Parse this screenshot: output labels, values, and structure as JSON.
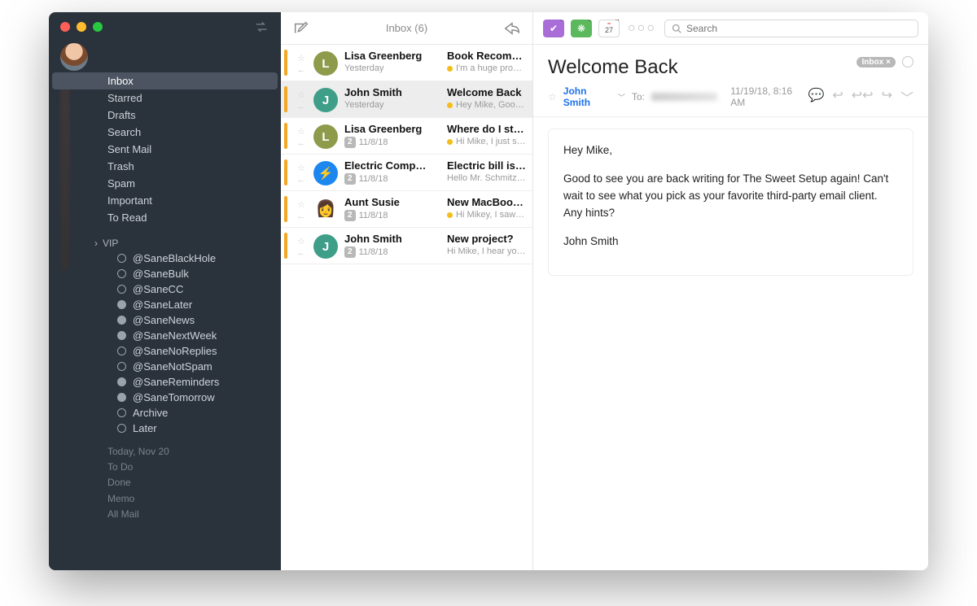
{
  "sidebar": {
    "folders": [
      "Inbox",
      "Starred",
      "Drafts",
      "Search",
      "Sent Mail",
      "Trash",
      "Spam",
      "Important",
      "To Read"
    ],
    "selected_index": 0,
    "vip_label": "VIP",
    "sane": [
      "@SaneBlackHole",
      "@SaneBulk",
      "@SaneCC",
      "@SaneLater",
      "@SaneNews",
      "@SaneNextWeek",
      "@SaneNoReplies",
      "@SaneNotSpam",
      "@SaneReminders",
      "@SaneTomorrow",
      "Archive",
      "Later"
    ],
    "footer": [
      "Today, Nov 20",
      "To Do",
      "Done",
      "Memo",
      "All Mail"
    ]
  },
  "list": {
    "title": "Inbox (6)",
    "messages": [
      {
        "sender": "Lisa Greenberg",
        "date": "Yesterday",
        "count": "",
        "subject": "Book Recomme…",
        "preview": "I'm a huge producti…",
        "avatar": "L",
        "avclass": "av-l",
        "dot": true
      },
      {
        "sender": "John Smith",
        "date": "Yesterday",
        "count": "",
        "subject": "Welcome Back",
        "preview": "Hey Mike, Good to…",
        "avatar": "J",
        "avclass": "av-j",
        "dot": true,
        "selected": true
      },
      {
        "sender": "Lisa Greenberg",
        "date": "11/8/18",
        "count": "2",
        "subject": "Where do I sta…",
        "preview": "Hi Mike, I just starte…",
        "avatar": "L",
        "avclass": "av-l",
        "dot": true
      },
      {
        "sender": "Electric Comp…",
        "date": "11/8/18",
        "count": "2",
        "subject": "Electric bill is…",
        "preview": "Hello Mr. Schmitz,…",
        "avatar": "⚡",
        "avclass": "av-e",
        "dot": false
      },
      {
        "sender": "Aunt Susie",
        "date": "11/8/18",
        "count": "2",
        "subject": "New MacBoo…",
        "preview": "Hi Mikey, I saw the…",
        "avatar": "",
        "avclass": "av-face",
        "dot": true
      },
      {
        "sender": "John Smith",
        "date": "11/8/18",
        "count": "2",
        "subject": "New project?",
        "preview": "Hi Mike, I hear you'…",
        "avatar": "J",
        "avclass": "av-j",
        "dot": false
      }
    ]
  },
  "reader": {
    "search_placeholder": "Search",
    "title": "Welcome Back",
    "tag": "Inbox",
    "from": "John Smith",
    "to_label": "To:",
    "timestamp": "11/19/18, 8:16 AM",
    "body_lines": [
      "Hey Mike,",
      "Good to see you are back writing for The Sweet Setup again! Can't wait to see what you pick as your favorite third-party email client. Any hints?",
      "John Smith"
    ],
    "cal_day": "27"
  }
}
